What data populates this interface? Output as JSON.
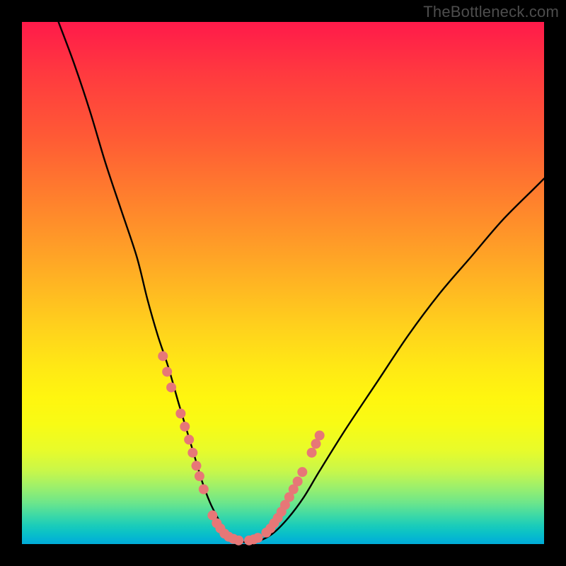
{
  "watermark_text": "TheBottleneck.com",
  "colors": {
    "frame_bg": "#000000",
    "gradient_top": "#ff1a4a",
    "gradient_bottom": "#00acd8",
    "curve": "#000000",
    "marker": "#e77777",
    "watermark": "#4d4d4d"
  },
  "chart_data": {
    "type": "line",
    "title": "",
    "xlabel": "",
    "ylabel": "",
    "xlim": [
      0,
      100
    ],
    "ylim": [
      0,
      100
    ],
    "grid": false,
    "legend": false,
    "annotations": [
      "TheBottleneck.com"
    ],
    "note": "V-shaped bottleneck curve. x and y are percentages of the plot area (0 = left/bottom, 100 = right/top). Background color encodes severity: red (top) = high bottleneck, green/teal (bottom) = optimal.",
    "series": [
      {
        "name": "bottleneck-curve",
        "x": [
          7,
          10,
          13,
          16,
          19,
          22,
          24,
          26,
          28,
          30,
          31.5,
          33,
          34.5,
          36,
          37.5,
          39,
          42,
          45,
          48,
          51,
          54,
          57,
          62,
          68,
          74,
          80,
          86,
          92,
          98,
          100
        ],
        "y": [
          100,
          92,
          83,
          73,
          64,
          55,
          47,
          40,
          34,
          27,
          22,
          17,
          12,
          8,
          5,
          2.5,
          0.5,
          0.5,
          2,
          5,
          9,
          14,
          22,
          31,
          40,
          48,
          55,
          62,
          68,
          70
        ]
      }
    ],
    "markers": {
      "name": "highlighted-points",
      "note": "Salmon bead markers along the lower V section of the curve.",
      "x": [
        27.0,
        27.8,
        28.6,
        30.4,
        31.2,
        32.0,
        32.7,
        33.4,
        34.0,
        34.8,
        36.5,
        37.3,
        38.0,
        38.8,
        39.6,
        40.5,
        41.5,
        43.5,
        44.4,
        45.2,
        46.8,
        47.6,
        48.3,
        49.0,
        49.7,
        50.4,
        51.2,
        52.0,
        52.8,
        53.7,
        55.5,
        56.3,
        57.0
      ],
      "y": [
        36.0,
        33.0,
        30.0,
        25.0,
        22.5,
        20.0,
        17.5,
        15.0,
        13.0,
        10.5,
        5.5,
        4.0,
        3.0,
        2.0,
        1.4,
        1.0,
        0.7,
        0.7,
        0.9,
        1.2,
        2.2,
        3.0,
        4.0,
        5.0,
        6.2,
        7.5,
        9.0,
        10.5,
        12.0,
        13.8,
        17.5,
        19.2,
        20.8
      ]
    }
  }
}
